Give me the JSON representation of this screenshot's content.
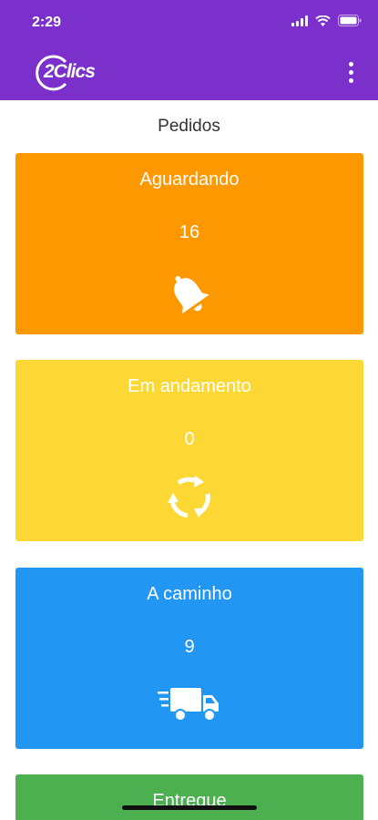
{
  "status_bar": {
    "time": "2:29"
  },
  "header": {
    "logo_text": "2Clics",
    "menu_icon": "more-vert-icon"
  },
  "page": {
    "title": "Pedidos"
  },
  "cards": [
    {
      "title": "Aguardando",
      "count": "16",
      "icon": "bell-icon",
      "color": "#fe9800"
    },
    {
      "title": "Em andamento",
      "count": "0",
      "icon": "refresh-cycle-icon",
      "color": "#fdd835"
    },
    {
      "title": "A caminho",
      "count": "9",
      "icon": "delivery-truck-icon",
      "color": "#2196f3"
    },
    {
      "title": "Entregue",
      "color": "#4caf50"
    }
  ],
  "colors": {
    "header": "#7b2fcb"
  }
}
